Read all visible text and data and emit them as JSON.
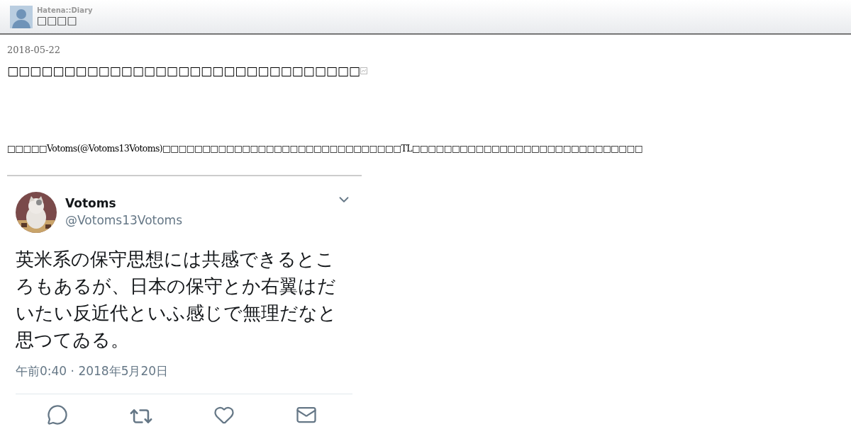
{
  "header": {
    "brand": "Hatena::Diary",
    "title": "□□□□"
  },
  "entry": {
    "date": "2018-05-22",
    "heading": "□□□□□□□□□□□□□□□□□□□□□□□□□□□□□□□",
    "paragraph": [
      {
        "kind": "link",
        "text": "□□□□"
      },
      {
        "kind": "text",
        "text": "□Votoms(@Votoms13Votoms)□□□□□□□□□□□□□□□□□□□□□□□□□□□□□□TL□□□□□□□□□□□□□□□□□□□□□"
      },
      {
        "kind": "link",
        "text": "□□"
      },
      {
        "kind": "text",
        "text": "□□□□□□"
      }
    ]
  },
  "tweet": {
    "name": "Votoms",
    "handle": "@Votoms13Votoms",
    "body": "英米系の保守思想には共感できるところもあるが、日本の保守とか右翼はだいたい反近代といふ感じで無理だなと思つてゐる。",
    "time": "午前0:40 · 2018年5月20日"
  }
}
